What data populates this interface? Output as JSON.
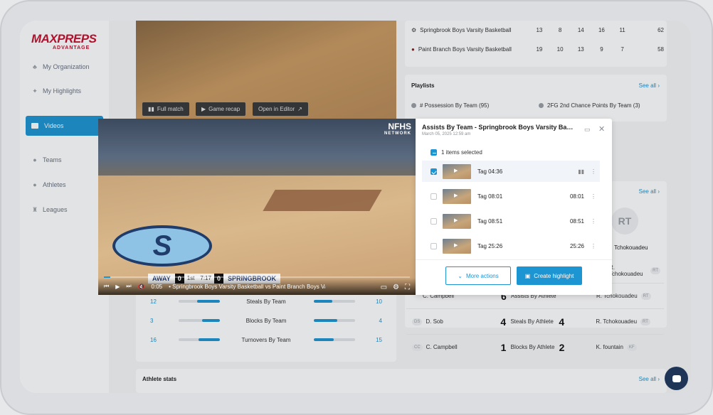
{
  "brand": {
    "logo_main": "MAXPREPS",
    "logo_sub": "ADVANTAGE"
  },
  "sidebar": {
    "items": [
      {
        "label": "My Organization",
        "icon": "org-icon"
      },
      {
        "label": "My Highlights",
        "icon": "sparkle-icon"
      },
      {
        "label": "Videos",
        "icon": "video-icon",
        "active": true
      },
      {
        "label": "Teams",
        "icon": "teams-icon"
      },
      {
        "label": "Athletes",
        "icon": "athlete-icon"
      },
      {
        "label": "Leagues",
        "icon": "trophy-icon"
      }
    ]
  },
  "bg_video": {
    "btn_full_match": "Full match",
    "btn_game_recap": "Game recap",
    "btn_open_editor": "Open in Editor"
  },
  "boxscore": {
    "rows": [
      {
        "team": "Springbrook Boys Varsity Basketball",
        "q": [
          "13",
          "8",
          "14",
          "16",
          "11"
        ],
        "total": "62"
      },
      {
        "team": "Paint Branch Boys Varsity Basketball",
        "q": [
          "19",
          "10",
          "13",
          "9",
          "7"
        ],
        "total": "58"
      }
    ]
  },
  "playlists": {
    "title": "Playlists",
    "see_all": "See all",
    "items": [
      "# Possession By Team (95)",
      "2FG 2nd Chance Points By Team (3)"
    ]
  },
  "leaders": {
    "see_all": "See all",
    "avatar": "RT",
    "featured_name": "Tchokouadeu",
    "rows": [
      {
        "name": "R. Tchokouadeu",
        "badge": "RT"
      },
      {
        "left_name": "C. Campbell",
        "left_val": "6",
        "label": "Assists By Athlete",
        "right_name": "R. Tchokouadeu",
        "badge": "RT"
      },
      {
        "left_badge": "DS",
        "left_name": "D. Sob",
        "left_val": "4",
        "label": "Steals By Athlete",
        "right_val": "4",
        "right_name": "R. Tchokouadeu",
        "badge": "RT"
      },
      {
        "left_badge": "CC",
        "left_name": "C. Campbell",
        "left_val": "1",
        "label": "Blocks By Athlete",
        "right_val": "2",
        "right_name": "K. fountain",
        "badge": "KF"
      }
    ]
  },
  "team_stats": {
    "rows": [
      {
        "left": "12",
        "label": "Steals By Team",
        "right": "10",
        "left_frac": 0.55,
        "right_frac": 0.45
      },
      {
        "left": "3",
        "label": "Blocks By Team",
        "right": "4",
        "left_frac": 0.43,
        "right_frac": 0.57
      },
      {
        "left": "16",
        "label": "Turnovers By Team",
        "right": "15",
        "left_frac": 0.52,
        "right_frac": 0.48
      }
    ]
  },
  "athlete_stats": {
    "title": "Athlete stats",
    "see_all": "See all"
  },
  "player": {
    "network": "NFHS",
    "network_sub": "NETWORK",
    "scorebug": {
      "away": "AWAY",
      "away_score": "0",
      "period": "1st",
      "clock": "7:17",
      "home_score": "0",
      "home": "SPRINGBROOK"
    },
    "time": "0:05",
    "title": "• Springbrook Boys Varsity Basketball vs Paint Branch Boys Varsity Basketball",
    "progress": 0.02
  },
  "panel": {
    "title": "Assists By Team - Springbrook Boys Varsity Basketball",
    "date": "March 05, 2025 12:59 am",
    "selected_label": "1 items selected",
    "clips": [
      {
        "name": "Tag 04:36",
        "duration": "",
        "checked": true
      },
      {
        "name": "Tag 08:01",
        "duration": "08:01",
        "checked": false
      },
      {
        "name": "Tag 08:51",
        "duration": "08:51",
        "checked": false
      },
      {
        "name": "Tag 25:26",
        "duration": "25:26",
        "checked": false
      }
    ],
    "more_actions": "More actions",
    "create_highlight": "Create highlight"
  }
}
